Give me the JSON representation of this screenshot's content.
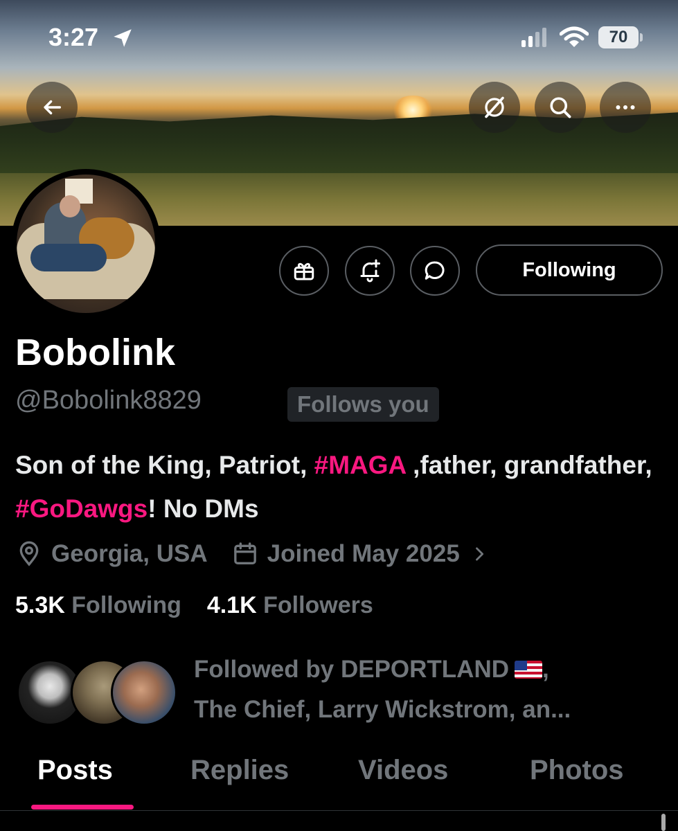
{
  "status_bar": {
    "time": "3:27",
    "battery": "70"
  },
  "header": {
    "back_icon": "arrow-left-icon",
    "actions": [
      "grok-icon",
      "search-icon",
      "more-icon"
    ]
  },
  "profile": {
    "name": "Bobolink",
    "handle": "@Bobolink8829",
    "follows_you": "Follows you",
    "bio_parts": {
      "p1": "Son of the King, Patriot, ",
      "tag1": "#MAGA",
      "p2": " ,father, grandfather, ",
      "tag2": "#GoDawgs",
      "p3": "! No DMs"
    },
    "location": "Georgia, USA",
    "joined": "Joined May 2025",
    "following_count": "5.3K",
    "following_label": "Following",
    "followers_count": "4.1K",
    "followers_label": "Followers",
    "followed_by": {
      "prefix": "Followed by DEPORTLAND",
      "line2": ",",
      "rest": "The Chief, Larry Wickstrom, an..."
    }
  },
  "actions": {
    "following_button": "Following",
    "icons": [
      "gift-icon",
      "bell-plus-icon",
      "message-icon"
    ]
  },
  "tabs": [
    "Posts",
    "Replies",
    "Videos",
    "Photos"
  ],
  "colors": {
    "accent": "#f91880",
    "muted": "#71767b",
    "background": "#000000"
  }
}
